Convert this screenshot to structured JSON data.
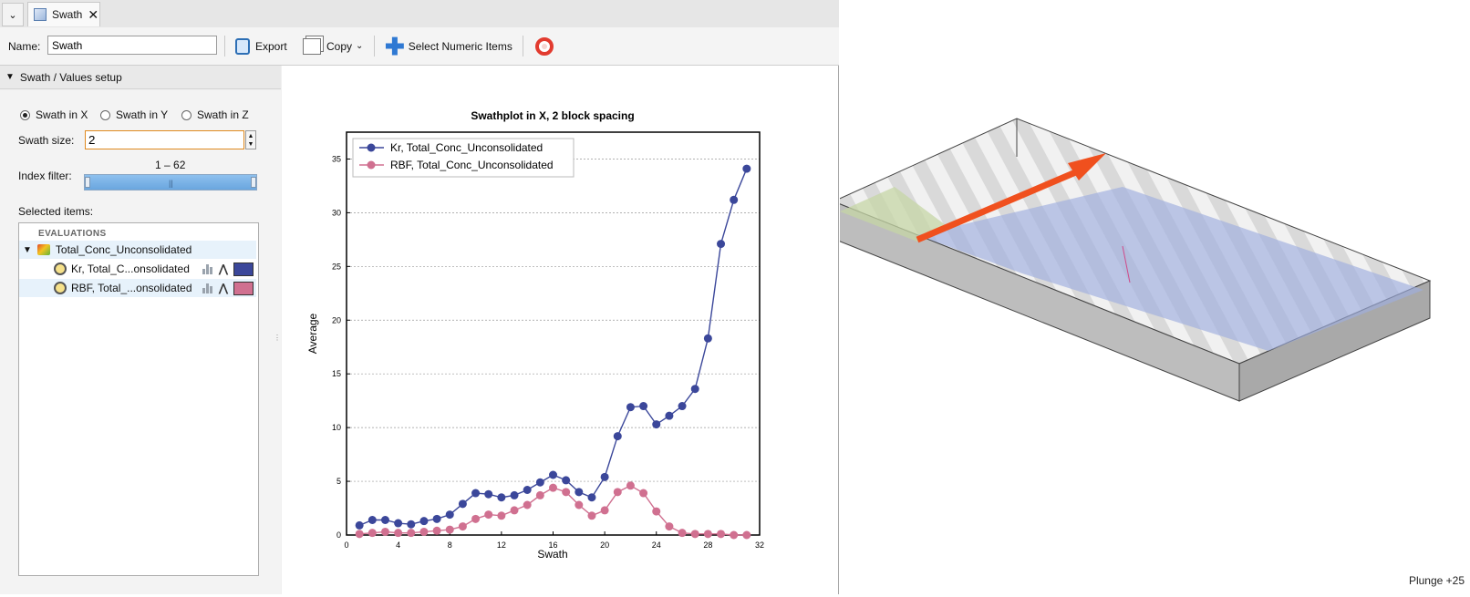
{
  "tab": {
    "title": "Swath",
    "close_glyph": "✕",
    "dropdown_glyph": "⌄"
  },
  "toolbar": {
    "name_label": "Name:",
    "name_value": "Swath",
    "export_label": "Export",
    "copy_label": "Copy",
    "select_label": "Select Numeric Items",
    "icons": [
      "export-icon",
      "copy-icon",
      "plus-icon",
      "help-lifebuoy-icon"
    ]
  },
  "setup": {
    "section_title": "Swath / Values setup",
    "radios": [
      {
        "label": "Swath in X",
        "checked": true
      },
      {
        "label": "Swath in Y",
        "checked": false
      },
      {
        "label": "Swath in Z",
        "checked": false
      }
    ],
    "swath_size_label": "Swath size:",
    "swath_size_value": "2",
    "index_filter_label": "Index filter:",
    "index_range": "1 – 62",
    "selected_items_label": "Selected items:",
    "tree": {
      "category": "EVALUATIONS",
      "parent": "Total_Conc_Unconsolidated",
      "children": [
        {
          "label": "Kr, Total_C...onsolidated",
          "color": "#3b479a"
        },
        {
          "label": "RBF, Total_...onsolidated",
          "color": "#d07090"
        }
      ]
    }
  },
  "chart_data": {
    "type": "line",
    "title": "Swathplot in X, 2 block spacing",
    "xlabel": "Swath",
    "ylabel": "Average",
    "xlim": [
      0,
      32
    ],
    "ylim": [
      0,
      37.5
    ],
    "xticks": [
      0,
      4,
      8,
      12,
      16,
      20,
      24,
      28,
      32
    ],
    "yticks": [
      0,
      5,
      10,
      15,
      20,
      25,
      30,
      35
    ],
    "grid": true,
    "legend_position": "top-left",
    "series": [
      {
        "name": "Kr, Total_Conc_Unconsolidated",
        "color": "#3b479a",
        "x": [
          1,
          2,
          3,
          4,
          5,
          6,
          7,
          8,
          9,
          10,
          11,
          12,
          13,
          14,
          15,
          16,
          17,
          18,
          19,
          20,
          21,
          22,
          23,
          24,
          25,
          26,
          27,
          28,
          29,
          30,
          31
        ],
        "y": [
          0.9,
          1.4,
          1.4,
          1.1,
          1.0,
          1.3,
          1.5,
          1.9,
          2.9,
          3.9,
          3.8,
          3.5,
          3.7,
          4.2,
          4.9,
          5.6,
          5.1,
          4.0,
          3.5,
          5.4,
          9.2,
          11.9,
          12.0,
          10.3,
          11.1,
          12.0,
          13.6,
          18.3,
          27.1,
          31.2,
          34.1
        ]
      },
      {
        "name": "RBF, Total_Conc_Unconsolidated",
        "color": "#d07090",
        "x": [
          1,
          2,
          3,
          4,
          5,
          6,
          7,
          8,
          9,
          10,
          11,
          12,
          13,
          14,
          15,
          16,
          17,
          18,
          19,
          20,
          21,
          22,
          23,
          24,
          25,
          26,
          27,
          28,
          29,
          30,
          31
        ],
        "y": [
          0.1,
          0.2,
          0.3,
          0.2,
          0.2,
          0.3,
          0.4,
          0.5,
          0.8,
          1.5,
          1.9,
          1.8,
          2.3,
          2.8,
          3.7,
          4.4,
          4.0,
          2.8,
          1.8,
          2.3,
          4.0,
          4.6,
          3.9,
          2.2,
          0.8,
          0.2,
          0.1,
          0.1,
          0.1,
          0.0,
          0.0
        ]
      }
    ]
  },
  "viewer": {
    "plunge_label": "Plunge +25",
    "arrow_color": "#f0501e"
  }
}
